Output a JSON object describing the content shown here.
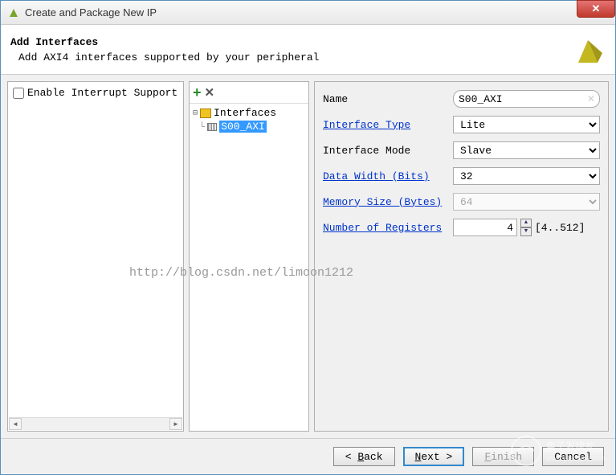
{
  "window": {
    "title": "Create and Package New IP"
  },
  "header": {
    "title": "Add Interfaces",
    "subtitle": "Add AXI4 interfaces supported by your peripheral"
  },
  "leftPanel": {
    "checkbox_label": "Enable Interrupt Support"
  },
  "tree": {
    "root": "Interfaces",
    "child": "S00_AXI"
  },
  "form": {
    "name_label": "Name",
    "name_value": "S00_AXI",
    "iftype_label": "Interface Type",
    "iftype_value": "Lite",
    "ifmode_label": "Interface Mode",
    "ifmode_value": "Slave",
    "datawidth_label": "Data Width (Bits)",
    "datawidth_value": "32",
    "memsize_label": "Memory Size (Bytes)",
    "memsize_value": "64",
    "numreg_label": "Number of Registers",
    "numreg_value": "4",
    "numreg_range": "[4..512]"
  },
  "footer": {
    "back": "Back",
    "next": "Next",
    "finish": "Finish",
    "cancel": "Cancel"
  },
  "watermark": "http://blog.csdn.net/limoon1212"
}
